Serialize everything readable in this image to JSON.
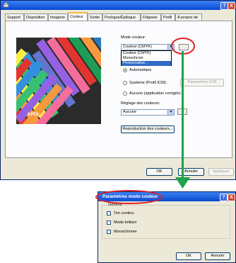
{
  "main_window": {
    "tabs": [
      {
        "label": "Support"
      },
      {
        "label": "Disposition"
      },
      {
        "label": "Imagerie"
      },
      {
        "label": "Couleur"
      },
      {
        "label": "Sortie"
      },
      {
        "label": "Prologue/Épilogue"
      },
      {
        "label": "Filigrane"
      },
      {
        "label": "Profil"
      },
      {
        "label": "À propos de"
      }
    ],
    "active_tab": "Couleur",
    "photo_caption": "KPDL",
    "color_mode": {
      "label": "Mode couleur:",
      "value": "Couleur (CMYK)",
      "options": [
        "Couleur (CMYK)",
        "Monochrom",
        "Personnalisé..."
      ],
      "selected_index": 2
    },
    "radios": [
      {
        "label": "Automatique",
        "checked": true
      },
      {
        "label": "Système (Profil ICM):",
        "checked": false
      },
      {
        "label": "Aucune (application corrigée)",
        "checked": false
      }
    ],
    "icm_button_label": "Paramètres ICM",
    "color_adjust": {
      "label": "Réglage des couleurs:",
      "value": "Aucune"
    },
    "reproduction_button_label": "Reproduction des couleurs...",
    "footer": {
      "ok": "OK",
      "cancel": "Annuler",
      "apply": "Appliquer"
    }
  },
  "dialog": {
    "title": "Paramètres mode couleur",
    "group_label": "Général",
    "checkboxes": [
      {
        "label": "Ton continu",
        "checked": false
      },
      {
        "label": "Mode brillant",
        "checked": false
      },
      {
        "label": "Monochrome",
        "checked": false
      }
    ],
    "ok": "OK",
    "cancel": "Annuler"
  },
  "icons": {
    "help": "?",
    "close": "X",
    "dropdown": "▼"
  },
  "colors": {
    "annotation_red": "#e02020",
    "annotation_green": "#1ea24a",
    "title_blue": "#0a4ad0"
  }
}
